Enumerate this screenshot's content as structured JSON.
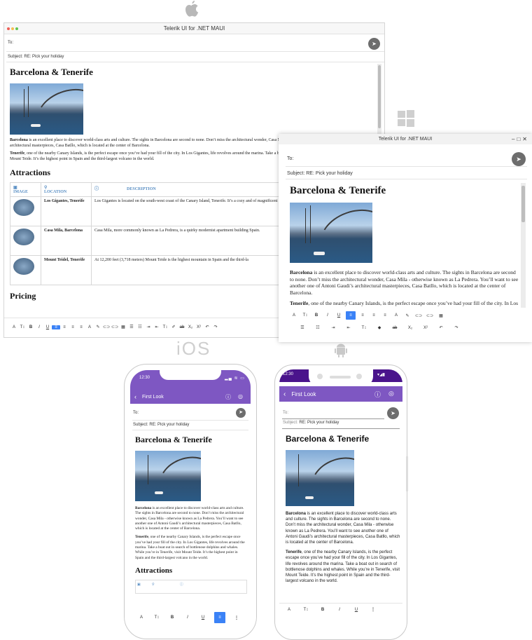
{
  "app_title": "Telerik UI for .NET MAUI",
  "platform_labels": {
    "ios": "iOS"
  },
  "icons": [
    "apple-logo-icon",
    "windows-logo-icon",
    "android-logo-icon",
    "send-icon",
    "back-icon",
    "info-icon",
    "theme-icon"
  ],
  "colors": {
    "accent": "#7e57c2",
    "android_status": "#4a148c",
    "toolbar_active": "#3b82f6",
    "table_header": "#5a8fc4"
  },
  "compose": {
    "to_label": "To:",
    "subject_label": "Subject:",
    "subject_value": "RE: Pick your holiday"
  },
  "mobile": {
    "title": "First Look",
    "ios_time": "12:30",
    "android_time": "12:30"
  },
  "doc": {
    "heading": "Barcelona & Tenerife",
    "p1_bold": "Barcelona",
    "p1_desktop": " is an excellent place to discover world-class arts and culture. The sights in Barcelona are second to none. Don’t miss the architectural wonder, Casa Mila - otherwise known as La Pedrera. You’ll want to see another one of Antoni Gaudi’s architectural masterpieces, Casa Batllo, which is located at the center of Barcelona.",
    "p2_bold": "Tenerife",
    "p2_text": ", one of the nearby Canary Islands, is the perfect escape once you’ve had your fill of the city. In Los Gigantes, life revolves around the marina. Take a boat out in search of bottlenose dolphins and whales. While you’re in Tenerife, visit Mount Teide. It’s the highest point in Spain and the third-largest volcano in the world.",
    "attractions_heading": "Attractions",
    "pricing_heading": "Pricing",
    "table_headers": [
      "IMAGE",
      "LOCATION",
      "DESCRIPTION"
    ],
    "rows": [
      {
        "location": "Los Gigantes, Tenerife",
        "description": "Los Gigantes is located on the south-west coast of the Canary Island, Tenerife. It’s a cozy and of magnificent cliffs."
      },
      {
        "location": "Casa Mila, Barcelona",
        "description": "Casa Mila, more commonly known as La Pedrera, is a quirky modernist apartment building Spain."
      },
      {
        "location": "Mount Teidel, Tenerife",
        "description": "At 12,200 feet (3,718 meters) Mount Teide is the highest mountain in Spain and the third-la"
      }
    ]
  },
  "toolbar": {
    "font": "A",
    "font_size": "T↕",
    "bold": "B",
    "italic": "I",
    "underline": "U",
    "more": "⋮",
    "subscript": "X₂",
    "superscript": "X²",
    "strike": "ab",
    "undo": "↶",
    "redo": "↷"
  }
}
